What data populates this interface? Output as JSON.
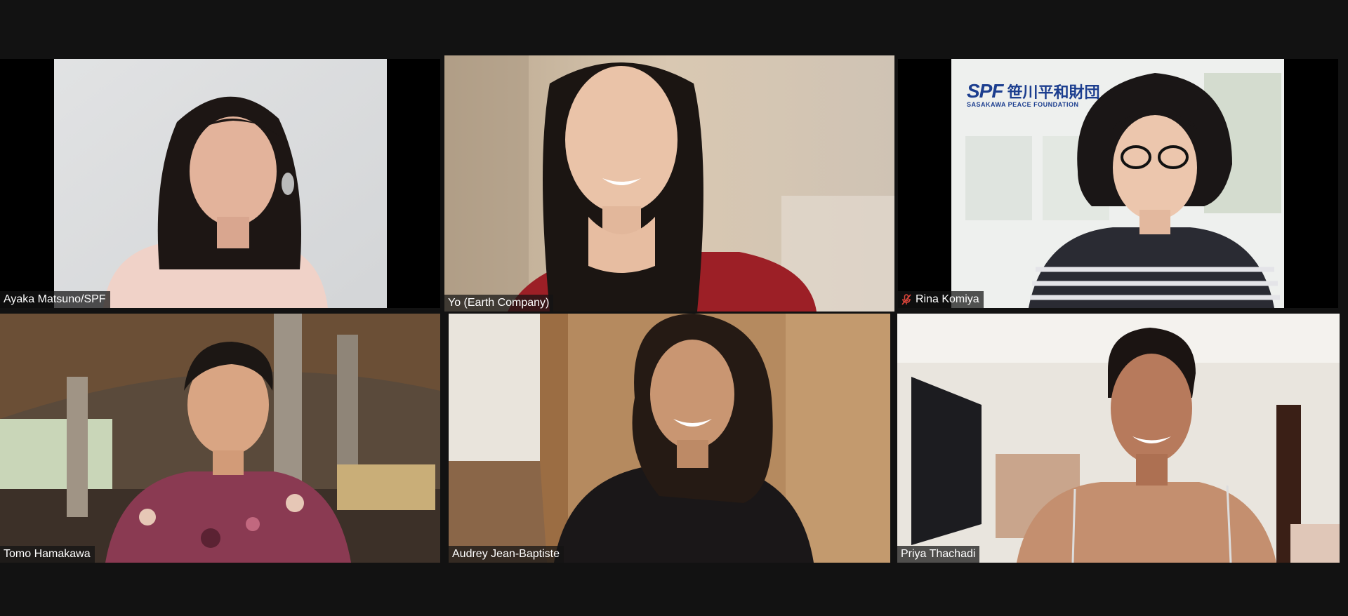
{
  "window": {
    "app": "Zoom Meeting",
    "view": "Gallery View"
  },
  "colors": {
    "background": "#121212",
    "active_speaker_border": "#e6ec7a",
    "muted_icon": "#e0463b"
  },
  "participants": [
    {
      "name": "Ayaka Matsuno/SPF",
      "muted": false,
      "active_speaker": false
    },
    {
      "name": "Yo (Earth Company)",
      "muted": false,
      "active_speaker": true
    },
    {
      "name": "Rina Komiya",
      "muted": true,
      "active_speaker": false,
      "background_logo": {
        "mark": "SPF",
        "japanese": "笹川平和財団",
        "english": "SASAKAWA PEACE FOUNDATION"
      }
    },
    {
      "name": "Tomo Hamakawa",
      "muted": false,
      "active_speaker": false
    },
    {
      "name": "Audrey Jean-Baptiste",
      "muted": false,
      "active_speaker": false
    },
    {
      "name": "Priya Thachadi",
      "muted": false,
      "active_speaker": false
    }
  ],
  "icons": [
    "mic-muted-icon"
  ]
}
